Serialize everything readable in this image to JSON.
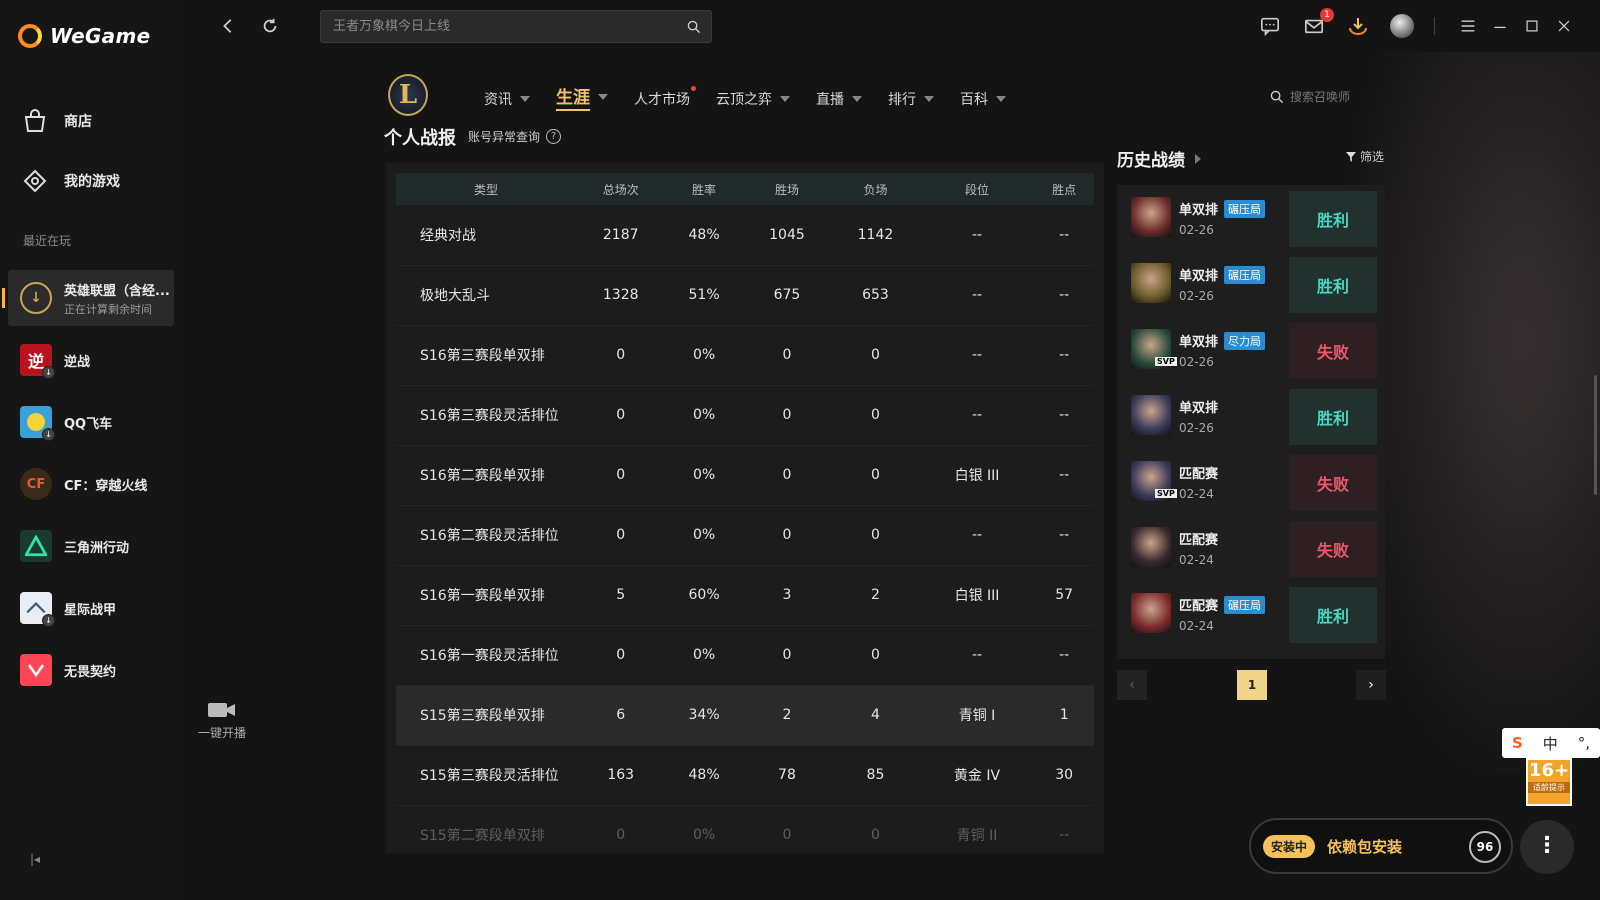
{
  "app": {
    "name": "WeGame"
  },
  "sidebar": {
    "nav": [
      {
        "label": "商店",
        "icon": "bag-icon"
      },
      {
        "label": "我的游戏",
        "icon": "controller-icon"
      }
    ],
    "recent_label": "最近在玩",
    "games": [
      {
        "name": "英雄联盟（含经...",
        "sub": "正在计算剩余时间",
        "icon": "lol-icon",
        "active": true
      },
      {
        "name": "逆战",
        "sub": "",
        "icon": "nizhan-icon"
      },
      {
        "name": "QQ飞车",
        "sub": "",
        "icon": "qqspeed-icon"
      },
      {
        "name": "CF：穿越火线",
        "sub": "",
        "icon": "cf-icon"
      },
      {
        "name": "三角洲行动",
        "sub": "",
        "icon": "delta-icon"
      },
      {
        "name": "星际战甲",
        "sub": "",
        "icon": "warframe-icon"
      },
      {
        "name": "无畏契约",
        "sub": "",
        "icon": "valorant-icon"
      }
    ]
  },
  "topbar": {
    "search_placeholder": "王者万象棋今日上线",
    "mail_badge": "1"
  },
  "main_nav": [
    {
      "label": "资讯",
      "caret": true,
      "active": false
    },
    {
      "label": "生涯",
      "caret": true,
      "active": true
    },
    {
      "label": "人才市场",
      "caret": false,
      "dot": true
    },
    {
      "label": "云顶之弈",
      "caret": true
    },
    {
      "label": "直播",
      "caret": true
    },
    {
      "label": "排行",
      "caret": true
    },
    {
      "label": "百科",
      "caret": true
    }
  ],
  "summoner_search_placeholder": "搜索召唤师",
  "profile": {
    "title": "个人战报",
    "abnormal_link": "账号异常查询"
  },
  "stats_table": {
    "headers": [
      "类型",
      "总场次",
      "胜率",
      "胜场",
      "负场",
      "段位",
      "胜点"
    ],
    "rows": [
      [
        "经典对战",
        "2187",
        "48%",
        "1045",
        "1142",
        "--",
        "--"
      ],
      [
        "极地大乱斗",
        "1328",
        "51%",
        "675",
        "653",
        "--",
        "--"
      ],
      [
        "S16第三赛段单双排",
        "0",
        "0%",
        "0",
        "0",
        "--",
        "--"
      ],
      [
        "S16第三赛段灵活排位",
        "0",
        "0%",
        "0",
        "0",
        "--",
        "--"
      ],
      [
        "S16第二赛段单双排",
        "0",
        "0%",
        "0",
        "0",
        "白银 III",
        "--"
      ],
      [
        "S16第二赛段灵活排位",
        "0",
        "0%",
        "0",
        "0",
        "--",
        "--"
      ],
      [
        "S16第一赛段单双排",
        "5",
        "60%",
        "3",
        "2",
        "白银 III",
        "57"
      ],
      [
        "S16第一赛段灵活排位",
        "0",
        "0%",
        "0",
        "0",
        "--",
        "--"
      ],
      [
        "S15第三赛段单双排",
        "6",
        "34%",
        "2",
        "4",
        "青铜 I",
        "1"
      ],
      [
        "S15第三赛段灵活排位",
        "163",
        "48%",
        "78",
        "85",
        "黄金 IV",
        "30"
      ],
      [
        "S15第二赛段单双排",
        "0",
        "0%",
        "0",
        "0",
        "青铜 II",
        "--"
      ]
    ]
  },
  "history": {
    "title": "历史战绩",
    "filter_label": "筛选",
    "matches": [
      {
        "mode": "单双排",
        "tag": "碾压局",
        "date": "02-26",
        "result": "胜利",
        "win": true,
        "svp": false,
        "color": "#6b2a2a"
      },
      {
        "mode": "单双排",
        "tag": "碾压局",
        "date": "02-26",
        "result": "胜利",
        "win": true,
        "svp": false,
        "color": "#6a5a2a"
      },
      {
        "mode": "单双排",
        "tag": "尽力局",
        "date": "02-26",
        "result": "失败",
        "win": false,
        "svp": true,
        "svp_label": "SVP",
        "color": "#2a4a3a"
      },
      {
        "mode": "单双排",
        "tag": "",
        "date": "02-26",
        "result": "胜利",
        "win": true,
        "svp": false,
        "color": "#3a3a5a"
      },
      {
        "mode": "匹配赛",
        "tag": "",
        "date": "02-24",
        "result": "失败",
        "win": false,
        "svp": true,
        "svp_label": "SVP",
        "color": "#3a3a5a"
      },
      {
        "mode": "匹配赛",
        "tag": "",
        "date": "02-24",
        "result": "失败",
        "win": false,
        "svp": false,
        "color": "#3a2a2e"
      },
      {
        "mode": "匹配赛",
        "tag": "碾压局",
        "date": "02-24",
        "result": "胜利",
        "win": true,
        "svp": false,
        "color": "#7a2a2a"
      }
    ],
    "current_page": "1"
  },
  "stream": {
    "label": "一键开播"
  },
  "install": {
    "status": "安装中",
    "text": "依赖包安装",
    "percent": "96"
  },
  "ime": {
    "lang": "中",
    "punct": "°,"
  },
  "age_rating": {
    "num": "16+",
    "sub": "适龄提示"
  }
}
